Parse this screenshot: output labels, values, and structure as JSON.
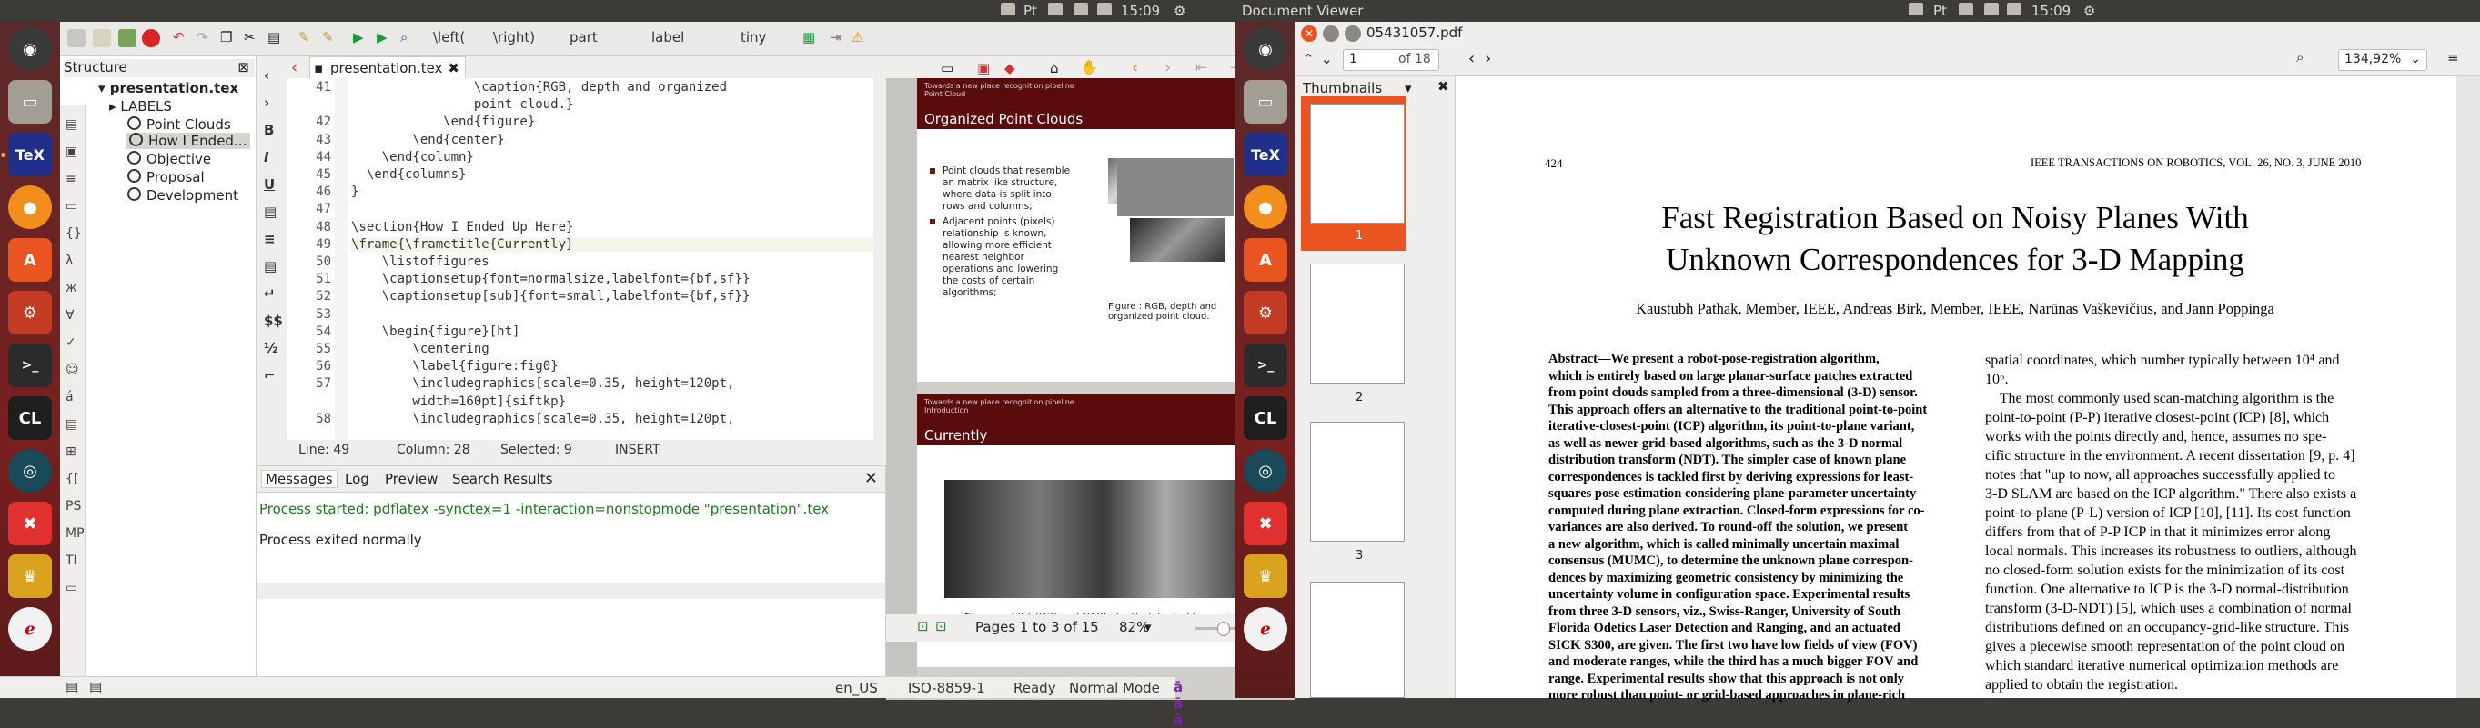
{
  "top_bar_left": {
    "time": "15:09",
    "title": ""
  },
  "top_bar_right": {
    "title": "Document Viewer",
    "time": "15:09"
  },
  "texmaker": {
    "toolbar": {
      "left_delim": "\\left(",
      "right_delim": "\\right)",
      "part": "part",
      "label": "label",
      "size": "tiny"
    },
    "structure": {
      "title": "Structure",
      "file": "presentation.tex",
      "labels": "LABELS",
      "items": [
        "Point Clouds",
        "How I Ended...",
        "Objective",
        "Proposal",
        "Development"
      ]
    },
    "tab": "presentation.tex",
    "code_lines": [
      {
        "n": "41",
        "t": "                \\caption{RGB, depth and organized"
      },
      {
        "n": "",
        "t": "                point cloud.}"
      },
      {
        "n": "42",
        "t": "            \\end{figure}"
      },
      {
        "n": "43",
        "t": "        \\end{center}"
      },
      {
        "n": "44",
        "t": "    \\end{column}"
      },
      {
        "n": "45",
        "t": "  \\end{columns}"
      },
      {
        "n": "46",
        "t": "}"
      },
      {
        "n": "47",
        "t": ""
      },
      {
        "n": "48",
        "t": "\\section{How I Ended Up Here}"
      },
      {
        "n": "49",
        "t": "\\frame{\\frametitle{Currently}"
      },
      {
        "n": "50",
        "t": "    \\listoffigures"
      },
      {
        "n": "51",
        "t": "    \\captionsetup{font=normalsize,labelfont={bf,sf}}"
      },
      {
        "n": "52",
        "t": "    \\captionsetup[sub]{font=small,labelfont={bf,sf}}"
      },
      {
        "n": "53",
        "t": ""
      },
      {
        "n": "54",
        "t": "    \\begin{figure}[ht]"
      },
      {
        "n": "55",
        "t": "        \\centering"
      },
      {
        "n": "56",
        "t": "        \\label{figure:fig0}"
      },
      {
        "n": "57",
        "t": "        \\includegraphics[scale=0.35, height=120pt,"
      },
      {
        "n": "",
        "t": "        width=160pt]{siftkp}"
      },
      {
        "n": "58",
        "t": "        \\includegraphics[scale=0.35, height=120pt,"
      }
    ],
    "status": {
      "line": "Line: 49",
      "column": "Column: 28",
      "selected": "Selected: 9",
      "mode": "INSERT"
    },
    "messages": {
      "tabs": [
        "Messages",
        "Log",
        "Preview",
        "Search Results"
      ],
      "line1": "Process started: pdflatex -synctex=1 -interaction=nonstopmode \"presentation\".tex",
      "line2": "Process exited normally"
    },
    "preview": {
      "slide1": {
        "head_small": "Towards a new place recognition pipeline",
        "head_sub": "Point Cloud",
        "title": "Organized Point Clouds",
        "bullet1": "Point clouds that resemble an matrix like structure, where data is split into rows and columns;",
        "bullet2": "Adjacent points (pixels) relationship is known, allowing more efficient nearest neighbor operations and lowering the costs of certain algorithms;",
        "caption": "Figure : RGB, depth and organized point cloud."
      },
      "slide2": {
        "head_small": "Towards a new place recognition pipeline",
        "head_sub": "Introduction",
        "title": "Currently",
        "caption_bold": "Figure :",
        "caption": " SIFT RGB and NARF depth detected key points."
      },
      "pages": "Pages 1 to 3 of 15",
      "zoom": "82%"
    },
    "bottom": {
      "lang": "en_US",
      "encoding": "ISO-8859-1",
      "ready": "Ready",
      "mode": "Normal Mode"
    }
  },
  "viewer": {
    "filename": "05431057.pdf",
    "page_input": "1",
    "page_of": "of 18",
    "zoom": "134,92%",
    "sidebar_title": "Thumbnails",
    "thumb_labels": [
      "1",
      "2",
      "3"
    ],
    "paper": {
      "page_no": "424",
      "journal": "IEEE TRANSACTIONS ON ROBOTICS, VOL. 26, NO. 3, JUNE 2010",
      "title1": "Fast Registration Based on Noisy Planes With",
      "title2": "Unknown Correspondences for 3-D Mapping",
      "authors": "Kaustubh Pathak, Member, IEEE, Andreas Birk, Member, IEEE, Narūnas Vaškevičius, and Jann Poppinga",
      "abstract": [
        "Abstract—We present a robot-pose-registration algorithm,",
        "which is entirely based on large planar-surface patches extracted",
        "from point clouds sampled from a three-dimensional (3-D) sensor.",
        "This approach offers an alternative to the traditional point-to-point",
        "iterative-closest-point (ICP) algorithm, its point-to-plane variant,",
        "as well as newer grid-based algorithms, such as the 3-D normal",
        "distribution transform (NDT). The simpler case of known plane",
        "correspondences is tackled first by deriving expressions for least-",
        "squares pose estimation considering plane-parameter uncertainty",
        "computed during plane extraction. Closed-form expressions for co-",
        "variances are also derived. To round-off the solution, we present",
        "a new algorithm, which is called minimally uncertain maximal",
        "consensus (MUMC), to determine the unknown plane correspon-",
        "dences by maximizing geometric consistency by minimizing the",
        "uncertainty volume in configuration space. Experimental results",
        "from three 3-D sensors, viz., Swiss-Ranger, University of South",
        "Florida Odetics Laser Detection and Ranging, and an actuated",
        "SICK S300, are given. The first two have low fields of view (FOV)",
        "and moderate ranges, while the third has a much bigger FOV and",
        "range. Experimental results show that this approach is not only",
        "more robust than point- or grid-based approaches in plane-rich"
      ],
      "right": [
        "spatial coordinates, which number typically between 10⁴ and",
        "10⁶.",
        "    The most commonly used scan-matching algorithm is the",
        "point-to-point (P-P) iterative closest-point (ICP) [8], which",
        "works with the points directly and, hence, assumes no spe-",
        "cific structure in the environment. A recent dissertation [9, p. 4]",
        "notes that \"up to now, all approaches successfully applied to",
        "3-D SLAM are based on the ICP algorithm.\" There also exists a",
        "point-to-plane (P-L) version of ICP [10], [11]. Its cost function",
        "differs from that of P-P ICP in that it minimizes error along",
        "local normals. This increases its robustness to outliers, although",
        "no closed-form solution exists for the minimization of its cost",
        "function. One alternative to ICP is the 3-D normal-distribution",
        "transform (3-D-NDT) [5], which uses a combination of normal",
        "distributions defined on an occupancy-grid-like structure. This",
        "gives a piecewise smooth representation of the point cloud on",
        "which standard iterative numerical optimization methods are",
        "applied to obtain the registration."
      ]
    }
  },
  "colors": {
    "accent": "#e95420",
    "slide_red": "#5a0b0b",
    "launcher": "#7a1f1f"
  }
}
